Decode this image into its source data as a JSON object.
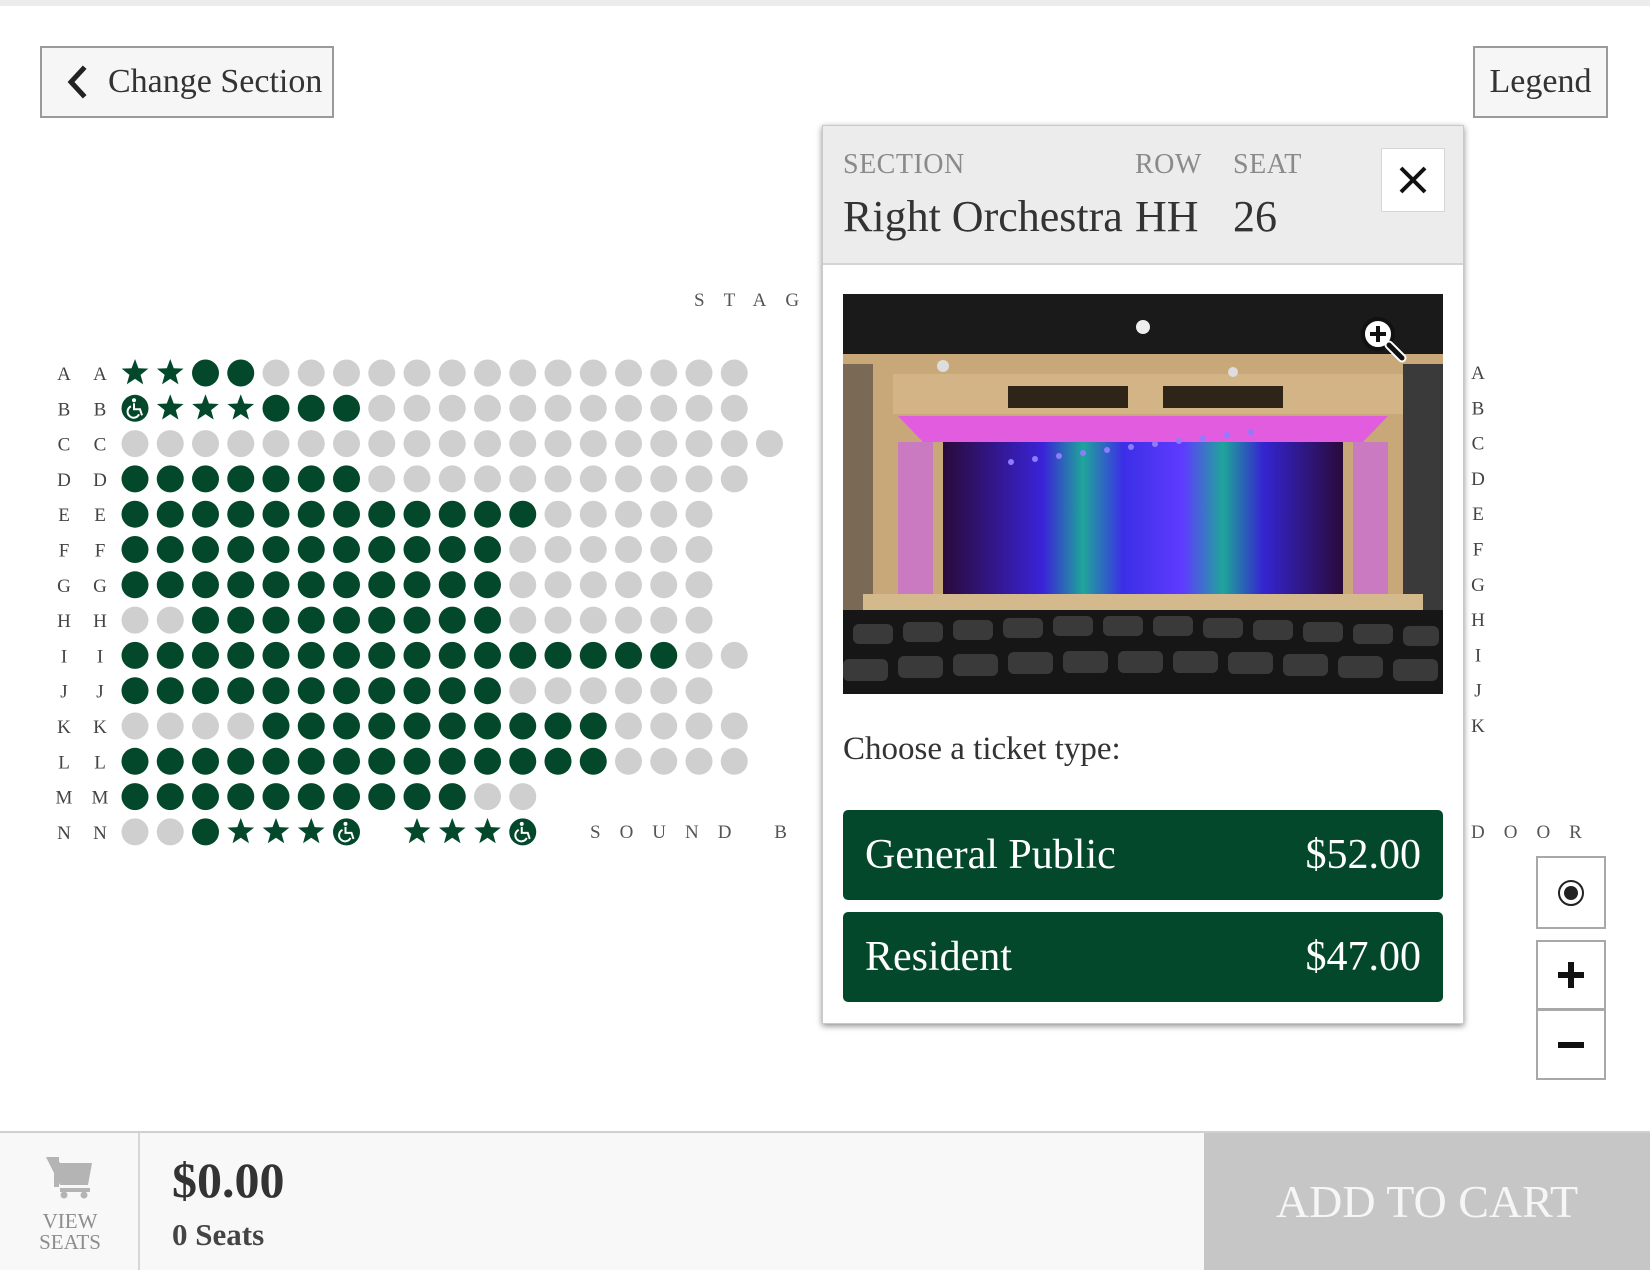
{
  "header": {
    "change_section_label": "Change Section",
    "legend_label": "Legend"
  },
  "map": {
    "stage_label": "STAG",
    "sound_label": "SOUND B",
    "door_label": "DOOR",
    "rows": [
      "A",
      "B",
      "C",
      "D",
      "E",
      "F",
      "G",
      "H",
      "I",
      "J",
      "K",
      "L",
      "M",
      "N"
    ],
    "right_rows": [
      "A",
      "B",
      "C",
      "D",
      "E",
      "F",
      "G",
      "H",
      "I",
      "J",
      "K"
    ],
    "seats": [
      "sscc..............",
      "wsssccc...........",
      "...................",
      "ccccccc...........",
      "cccccccccccc.....",
      "ccccccccccc......",
      "ccccccccccc......",
      "..ccccccccc......",
      "cccccccccccccccc..",
      "ccccccccccc......",
      "....cccccccccc....",
      "cccccccccccccc....",
      "cccccccccc..",
      "..cssswxsssw"
    ],
    "colors": {
      "available": "#03482b",
      "unavailable": "#cfcfcf",
      "accent": "#03482b"
    }
  },
  "popup": {
    "section_label": "SECTION",
    "row_label": "ROW",
    "seat_label": "SEAT",
    "section_value": "Right Orchestra",
    "row_value": "HH",
    "seat_value": "26",
    "choose_label": "Choose a ticket type:",
    "tickets": [
      {
        "name": "General Public",
        "price": "$52.00"
      },
      {
        "name": "Resident",
        "price": "$47.00"
      }
    ]
  },
  "footer": {
    "view_label_1": "VIEW",
    "view_label_2": "SEATS",
    "total": "$0.00",
    "seat_count": "0 Seats",
    "add_to_cart": "ADD TO CART"
  },
  "icons": {
    "back": "chevron-left-icon",
    "close": "close-icon",
    "zoom_photo": "zoom-in-icon",
    "reset": "recenter-icon",
    "zoom_in": "plus-icon",
    "zoom_out": "minus-icon",
    "cart": "cart-icon",
    "seat_accessible": "wheelchair-icon",
    "seat_special": "star-icon"
  }
}
